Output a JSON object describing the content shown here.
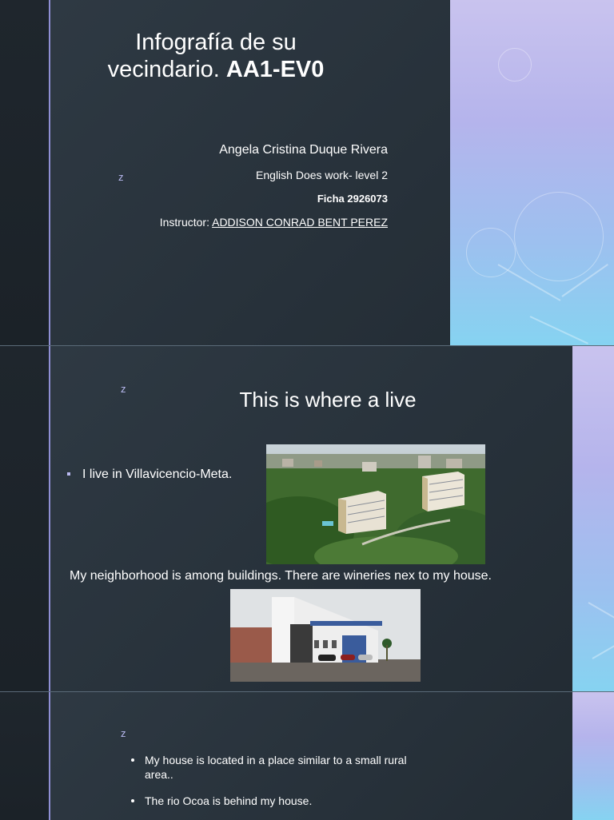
{
  "slide1": {
    "title_line1": "Infografía de su",
    "title_line2_normal": "vecindario.",
    "title_line2_bold": "AA1-EV0",
    "z_mark": "z",
    "author": "Angela Cristina Duque Rivera",
    "course": "English Does work- level 2",
    "ficha": "Ficha 2926073",
    "instructor_label": "Instructor:",
    "instructor_name": "ADDISON CONRAD BENT PEREZ"
  },
  "slide2": {
    "z_mark": "z",
    "title": "This is where a live",
    "bullet1": "I live in Villavicencio-Meta.",
    "paragraph": "My neighborhood is among buildings. There are wineries nex to my house."
  },
  "slide3": {
    "z_mark": "z",
    "bullet1_line1": "My house is located in a place similar to a small rural",
    "bullet1_line2": "area..",
    "bullet2": "The rio Ocoa is behind my house."
  },
  "colors": {
    "slide_bg": "#2b353f",
    "accent_line": "#8f8fd4",
    "accent_text": "#b9b9f0",
    "gradient_top": "#c9c3ee",
    "gradient_bottom": "#86d3f1"
  }
}
